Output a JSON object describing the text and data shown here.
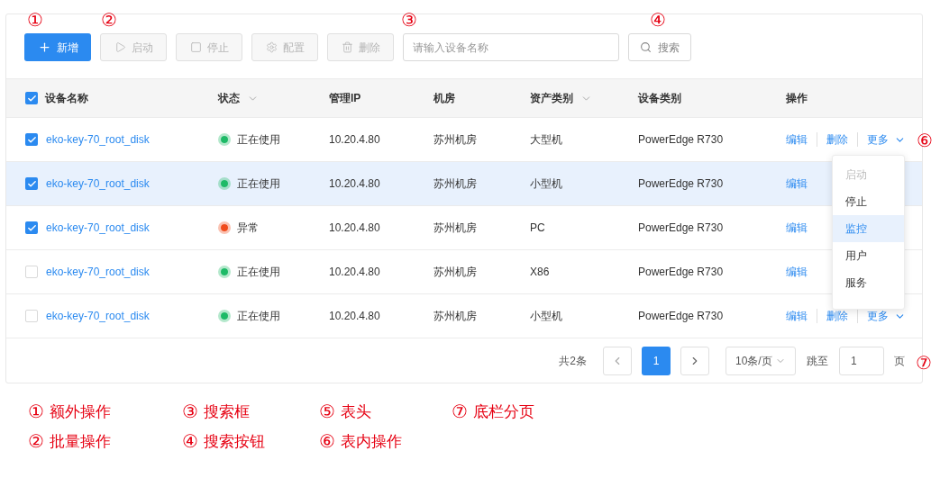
{
  "toolbar": {
    "buttons": [
      {
        "label": "新增",
        "kind": "primary",
        "disabled": false
      },
      {
        "label": "启动",
        "kind": "default",
        "disabled": true
      },
      {
        "label": "停止",
        "kind": "default",
        "disabled": true
      },
      {
        "label": "配置",
        "kind": "default",
        "disabled": true
      },
      {
        "label": "删除",
        "kind": "default",
        "disabled": true
      }
    ],
    "search": {
      "placeholder": "请输入设备名称"
    },
    "search_button": {
      "label": "搜索"
    }
  },
  "table": {
    "all_checked": true,
    "columns": [
      {
        "label": "设备名称",
        "filter": false
      },
      {
        "label": "状态",
        "filter": true
      },
      {
        "label": "管理IP",
        "filter": false
      },
      {
        "label": "机房",
        "filter": false
      },
      {
        "label": "资产类别",
        "filter": true
      },
      {
        "label": "设备类别",
        "filter": false
      },
      {
        "label": "操作",
        "filter": false
      }
    ],
    "rows": [
      {
        "checked": true,
        "hovered": false,
        "name": "eko-key-70_root_disk",
        "status": "正在使用",
        "color": "#1dba67",
        "ip": "10.20.4.80",
        "room": "苏州机房",
        "asset": "大型机",
        "device": "PowerEdge R730",
        "actions": [
          {
            "label": "编辑",
            "kind": "link"
          },
          {
            "label": "删除",
            "kind": "link"
          },
          {
            "label": "更多",
            "kind": "more"
          }
        ]
      },
      {
        "checked": true,
        "hovered": true,
        "name": "eko-key-70_root_disk",
        "status": "正在使用",
        "color": "#1dba67",
        "ip": "10.20.4.80",
        "room": "苏州机房",
        "asset": "小型机",
        "device": "PowerEdge R730",
        "actions": [
          {
            "label": "编辑",
            "kind": "link"
          }
        ]
      },
      {
        "checked": true,
        "hovered": false,
        "name": "eko-key-70_root_disk",
        "status": "异常",
        "color": "#f04b1c",
        "ip": "10.20.4.80",
        "room": "苏州机房",
        "asset": "PC",
        "device": "PowerEdge R730",
        "actions": [
          {
            "label": "编辑",
            "kind": "link"
          }
        ]
      },
      {
        "checked": false,
        "hovered": false,
        "name": "eko-key-70_root_disk",
        "status": "正在使用",
        "color": "#1dba67",
        "ip": "10.20.4.80",
        "room": "苏州机房",
        "asset": "X86",
        "device": "PowerEdge R730",
        "actions": [
          {
            "label": "编辑",
            "kind": "link"
          }
        ]
      },
      {
        "checked": false,
        "hovered": false,
        "name": "eko-key-70_root_disk",
        "status": "正在使用",
        "color": "#1dba67",
        "ip": "10.20.4.80",
        "room": "苏州机房",
        "asset": "小型机",
        "device": "PowerEdge R730",
        "actions": [
          {
            "label": "编辑",
            "kind": "link"
          },
          {
            "label": "删除",
            "kind": "link"
          },
          {
            "label": "更多",
            "kind": "more"
          }
        ]
      }
    ],
    "menu": {
      "items": [
        {
          "label": "启动",
          "disabled": true,
          "selected": false
        },
        {
          "label": "停止",
          "disabled": false,
          "selected": false
        },
        {
          "label": "监控",
          "disabled": false,
          "selected": true
        },
        {
          "label": "用户",
          "disabled": false,
          "selected": false
        },
        {
          "label": "服务",
          "disabled": false,
          "selected": false
        }
      ]
    }
  },
  "pagination": {
    "total": "共2条",
    "pages": [
      {
        "label": "1",
        "selected": true
      }
    ],
    "page_size": "10条/页",
    "jump_label": "跳至",
    "jump_value": "1",
    "page_unit": "页"
  },
  "annotations": [
    "①",
    "②",
    "③",
    "④",
    "⑥",
    "⑦"
  ],
  "legend": [
    {
      "mark": "①",
      "text": "额外操作"
    },
    {
      "mark": "②",
      "text": "批量操作"
    },
    {
      "mark": "③",
      "text": "搜索框"
    },
    {
      "mark": "④",
      "text": "搜索按钮"
    },
    {
      "mark": "⑤",
      "text": "表头"
    },
    {
      "mark": "⑥",
      "text": "表内操作"
    },
    {
      "mark": "⑦",
      "text": "底栏分页"
    }
  ]
}
